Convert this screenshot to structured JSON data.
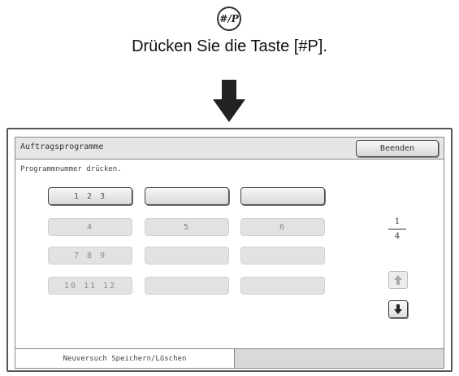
{
  "header": {
    "key_label": "#/P",
    "instruction": "Drücken Sie die Taste [#P]."
  },
  "panel": {
    "title": "Auftragsprogramme",
    "close_button": "Beenden",
    "prompt": "Programmnummer drücken.",
    "programs": [
      {
        "label": "1 2 3",
        "state": "active"
      },
      {
        "label": "",
        "state": "active"
      },
      {
        "label": "",
        "state": "active"
      },
      {
        "label": "4",
        "state": "inactive"
      },
      {
        "label": "5",
        "state": "inactive"
      },
      {
        "label": "6",
        "state": "inactive"
      },
      {
        "label": "7 8 9",
        "state": "inactive"
      },
      {
        "label": "",
        "state": "inactive"
      },
      {
        "label": "",
        "state": "inactive"
      },
      {
        "label": "10 11 12",
        "state": "inactive"
      },
      {
        "label": "",
        "state": "inactive"
      },
      {
        "label": "",
        "state": "inactive"
      }
    ],
    "page": {
      "current": "1",
      "total": "4"
    },
    "tabs": {
      "tab1": "Neuversuch Speichern/Löschen",
      "tab2": ""
    }
  },
  "icons": {
    "key": "key-hash-p-icon",
    "arrow": "down-arrow-icon",
    "scroll_up": "arrow-up-icon",
    "scroll_down": "arrow-down-icon"
  }
}
